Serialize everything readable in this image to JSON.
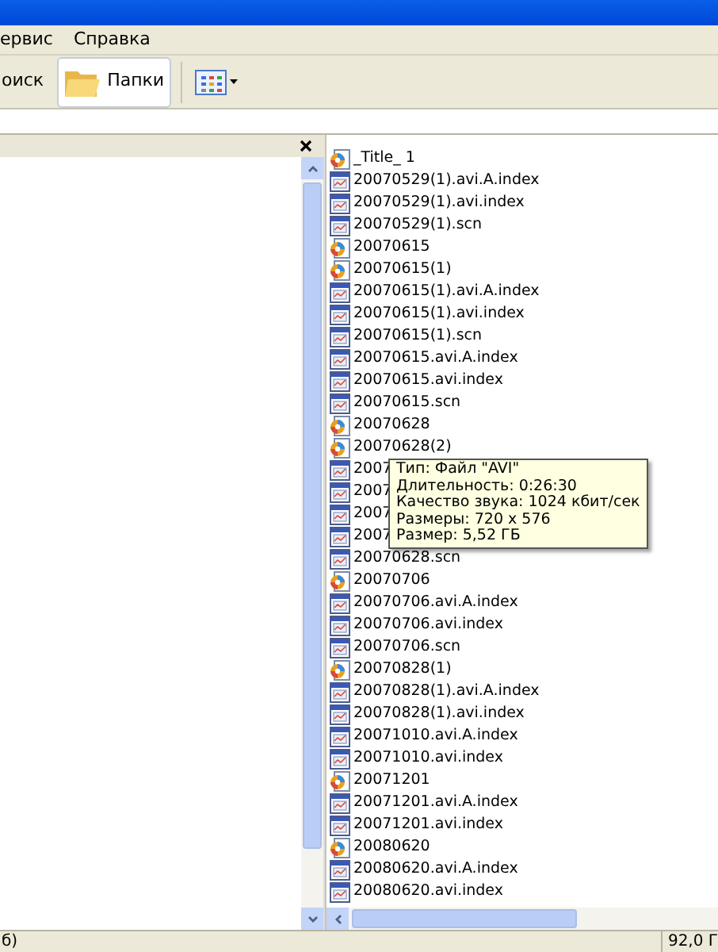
{
  "menu": [
    "ервис",
    "Справка"
  ],
  "toolbar": [
    {
      "label": "оиск",
      "kind": "text",
      "selected": false
    },
    {
      "label": "Папки",
      "kind": "folders",
      "selected": true
    }
  ],
  "files": [
    {
      "name": "_Title_ 1",
      "kind": "video"
    },
    {
      "name": "20070529(1).avi.A.index",
      "kind": "document"
    },
    {
      "name": "20070529(1).avi.index",
      "kind": "document"
    },
    {
      "name": "20070529(1).scn",
      "kind": "document"
    },
    {
      "name": "20070615",
      "kind": "video"
    },
    {
      "name": "20070615(1)",
      "kind": "video"
    },
    {
      "name": "20070615(1).avi.A.index",
      "kind": "document"
    },
    {
      "name": "20070615(1).avi.index",
      "kind": "document"
    },
    {
      "name": "20070615(1).scn",
      "kind": "document"
    },
    {
      "name": "20070615.avi.A.index",
      "kind": "document"
    },
    {
      "name": "20070615.avi.index",
      "kind": "document"
    },
    {
      "name": "20070615.scn",
      "kind": "document"
    },
    {
      "name": "20070628",
      "kind": "video"
    },
    {
      "name": "20070628(2)",
      "kind": "video"
    },
    {
      "name": "2007",
      "kind": "document"
    },
    {
      "name": "2007",
      "kind": "document"
    },
    {
      "name": "2007",
      "kind": "document"
    },
    {
      "name": "2007",
      "kind": "document"
    },
    {
      "name": "20070628.scn",
      "kind": "document"
    },
    {
      "name": "20070706",
      "kind": "video"
    },
    {
      "name": "20070706.avi.A.index",
      "kind": "document"
    },
    {
      "name": "20070706.avi.index",
      "kind": "document"
    },
    {
      "name": "20070706.scn",
      "kind": "document"
    },
    {
      "name": "20070828(1)",
      "kind": "video"
    },
    {
      "name": "20070828(1).avi.A.index",
      "kind": "document"
    },
    {
      "name": "20070828(1).avi.index",
      "kind": "document"
    },
    {
      "name": "20071010.avi.A.index",
      "kind": "document"
    },
    {
      "name": "20071010.avi.index",
      "kind": "document"
    },
    {
      "name": "20071201",
      "kind": "video"
    },
    {
      "name": "20071201.avi.A.index",
      "kind": "document"
    },
    {
      "name": "20071201.avi.index",
      "kind": "document"
    },
    {
      "name": "20080620",
      "kind": "video"
    },
    {
      "name": "20080620.avi.A.index",
      "kind": "document"
    },
    {
      "name": "20080620.avi.index",
      "kind": "document"
    }
  ],
  "tooltip": [
    "Тип: Файл \"AVI\"",
    "Длительность: 0:26:30",
    "Качество звука: 1024 кбит/сек",
    "Размеры: 720 x 576",
    "Размер: 5,52 ГБ"
  ],
  "status_bar": {
    "left": "б)",
    "right": "92,0 Г"
  }
}
